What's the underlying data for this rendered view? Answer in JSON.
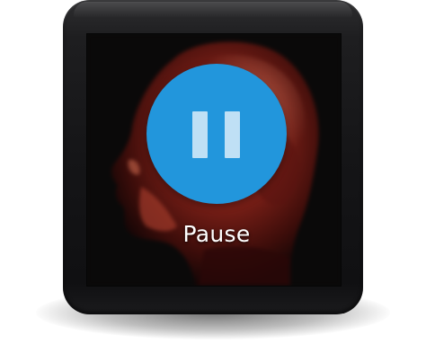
{
  "controls": {
    "pause_label": "Pause",
    "pause_icon": "pause-icon"
  },
  "colors": {
    "button": "#2296dc",
    "icon": "#bfe0f5",
    "label": "#ffffff"
  }
}
